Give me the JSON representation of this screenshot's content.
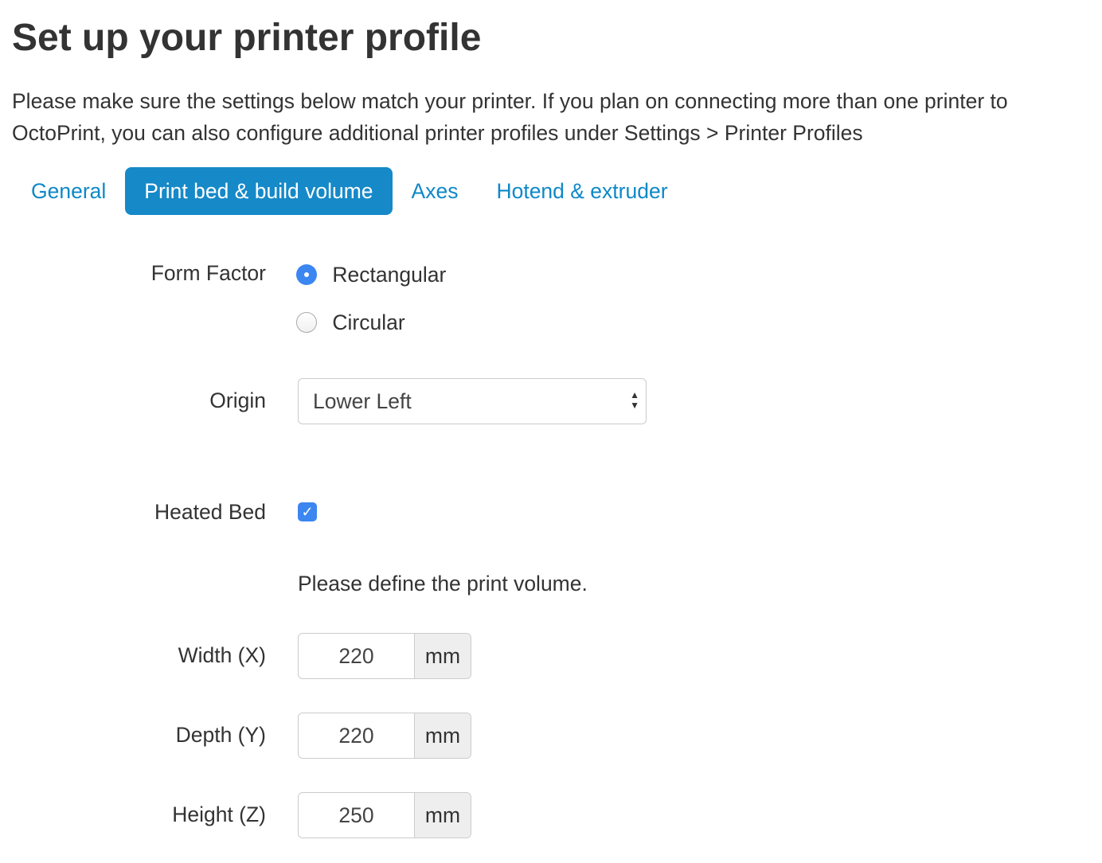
{
  "title": "Set up your printer profile",
  "intro": "Please make sure the settings below match your printer. If you plan on connecting more than one printer to OctoPrint, you can also configure additional printer profiles under Settings > Printer Profiles",
  "tabs": [
    {
      "label": "General"
    },
    {
      "label": "Print bed & build volume",
      "active": true
    },
    {
      "label": "Axes"
    },
    {
      "label": "Hotend & extruder"
    }
  ],
  "form_factor": {
    "label": "Form Factor",
    "options": [
      {
        "label": "Rectangular",
        "selected": true
      },
      {
        "label": "Circular",
        "selected": false
      }
    ]
  },
  "origin": {
    "label": "Origin",
    "value": "Lower Left"
  },
  "heated_bed": {
    "label": "Heated Bed",
    "checked": true
  },
  "volume_note": "Please define the print volume.",
  "dims": [
    {
      "label": "Width (X)",
      "value": "220",
      "unit": "mm"
    },
    {
      "label": "Depth (Y)",
      "value": "220",
      "unit": "mm"
    },
    {
      "label": "Height (Z)",
      "value": "250",
      "unit": "mm"
    }
  ],
  "colors": {
    "accent": "#1689c8",
    "link": "#0e88c8",
    "control": "#3b86f0"
  }
}
